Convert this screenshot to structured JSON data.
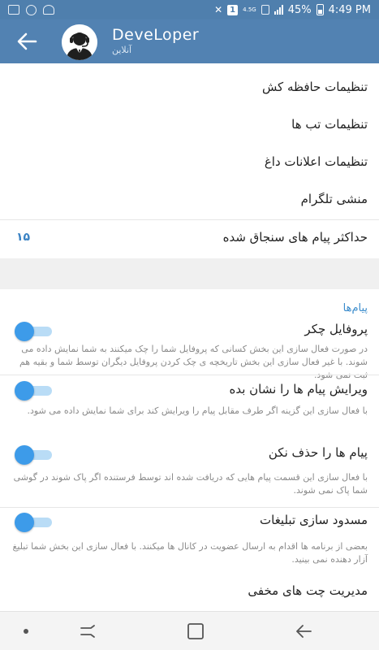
{
  "status_bar": {
    "notification_badge": "1",
    "network": "4.5G",
    "battery": "45%",
    "time": "4:49 PM"
  },
  "header": {
    "title": "DeveLoper",
    "subtitle": "آنلاین"
  },
  "menu": [
    {
      "label": "تنظیمات حافظه کش"
    },
    {
      "label": "تنظیمات تب ها"
    },
    {
      "label": "تنظیمات اعلانات داغ"
    },
    {
      "label": "منشی تلگرام"
    }
  ],
  "pinned": {
    "label": "حداکثر پیام های سنجاق شده",
    "value": "۱۵"
  },
  "messages_section": {
    "header": "پیام‌ها",
    "items": [
      {
        "label": "پروفایل چکر",
        "description": "در صورت فعال سازی این بخش کسانی که پروفایل شما را چک میکنند به شما نمایش داده می شوند. با غیر فعال سازی این بخش تاریخچه ی چک کردن پروفایل دیگران توسط شما و بقیه هم ثبت نمی شود.",
        "enabled": true
      },
      {
        "label": "ویرایش پیام ها را نشان بده",
        "description": "با فعال سازی این گزینه اگر طرف مقابل پیام را ویرایش کند برای شما نمایش داده می شود.",
        "enabled": true
      },
      {
        "label": "پیام ها را حذف نکن",
        "description": "با فعال سازی این قسمت پیام هایی که دریافت شده اند توسط فرستنده اگر پاک شوند در گوشی شما پاک نمی شوند.",
        "enabled": true
      },
      {
        "label": "مسدود سازی تبلیغات",
        "description": "بعضی از برنامه ها اقدام به ارسال عضویت در کانال ها میکنند. با فعال سازی این بخش شما تبلیغ آزار دهنده نمی بینید.",
        "enabled": true
      }
    ]
  },
  "hidden_chats": {
    "label": "مدیریت چت های مخفی"
  },
  "colors": {
    "header": "#5282b2",
    "status_bar": "#4f7fad",
    "accent": "#3d9be9"
  }
}
